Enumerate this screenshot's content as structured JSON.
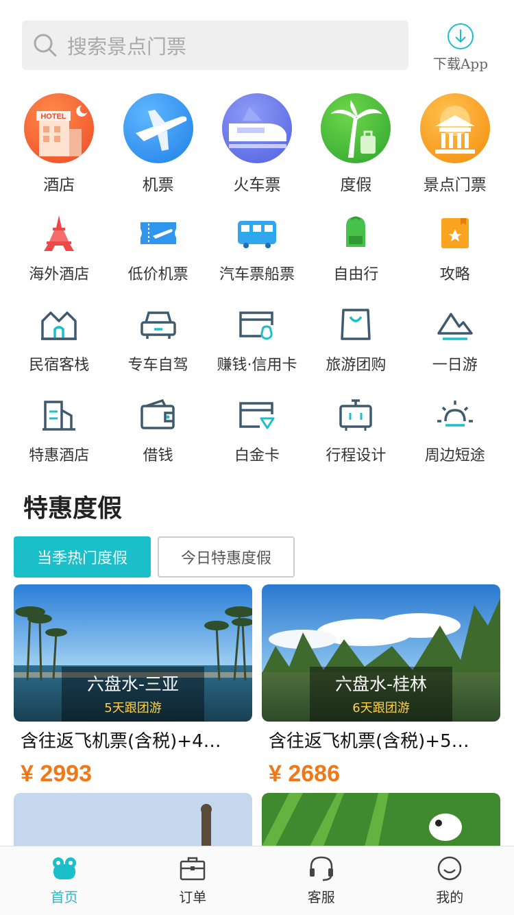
{
  "search": {
    "placeholder": "搜索景点门票"
  },
  "download": {
    "label": "下载App"
  },
  "top_categories": [
    {
      "label": "酒店",
      "icon": "hotel-icon",
      "color": "#f0552a"
    },
    {
      "label": "机票",
      "icon": "airplane-icon",
      "color": "#2c8ff0"
    },
    {
      "label": "火车票",
      "icon": "train-icon",
      "color": "#5d70e8"
    },
    {
      "label": "度假",
      "icon": "palm-tree-icon",
      "color": "#3bbd3b"
    },
    {
      "label": "景点门票",
      "icon": "temple-icon",
      "color": "#f6920f"
    }
  ],
  "grid": [
    [
      {
        "label": "海外酒店",
        "icon": "eiffel-tower-icon"
      },
      {
        "label": "低价机票",
        "icon": "plane-ticket-icon"
      },
      {
        "label": "汽车票船票",
        "icon": "bus-icon"
      },
      {
        "label": "自由行",
        "icon": "backpack-icon"
      },
      {
        "label": "攻略",
        "icon": "guide-book-icon"
      }
    ],
    [
      {
        "label": "民宿客栈",
        "icon": "house-icon"
      },
      {
        "label": "专车自驾",
        "icon": "car-icon"
      },
      {
        "label": "赚钱·信用卡",
        "icon": "credit-card-icon"
      },
      {
        "label": "旅游团购",
        "icon": "shopping-bag-icon"
      },
      {
        "label": "一日游",
        "icon": "mountain-icon"
      }
    ],
    [
      {
        "label": "特惠酒店",
        "icon": "building-icon"
      },
      {
        "label": "借钱",
        "icon": "wallet-icon"
      },
      {
        "label": "白金卡",
        "icon": "platinum-card-icon"
      },
      {
        "label": "行程设计",
        "icon": "suitcase-icon"
      },
      {
        "label": "周边短途",
        "icon": "sunrise-icon"
      }
    ]
  ],
  "section": {
    "title": "特惠度假",
    "tabs": [
      "当季热门度假",
      "今日特惠度假"
    ]
  },
  "cards": [
    {
      "dest": "六盘水-三亚",
      "days": "5天跟团游",
      "title": "含往返飞机票(含税)+4…",
      "price": "¥ 2993"
    },
    {
      "dest": "六盘水-桂林",
      "days": "6天跟团游",
      "title": "含往返飞机票(含税)+5…",
      "price": "¥ 2686"
    }
  ],
  "tabbar": [
    {
      "label": "首页",
      "icon": "home-frog-icon",
      "active": true
    },
    {
      "label": "订单",
      "icon": "briefcase-icon",
      "active": false
    },
    {
      "label": "客服",
      "icon": "headset-icon",
      "active": false
    },
    {
      "label": "我的",
      "icon": "smile-icon",
      "active": false
    }
  ],
  "colors": {
    "accent": "#1bbfca",
    "price": "#f07818",
    "dark_icon": "#3f5a6e"
  }
}
